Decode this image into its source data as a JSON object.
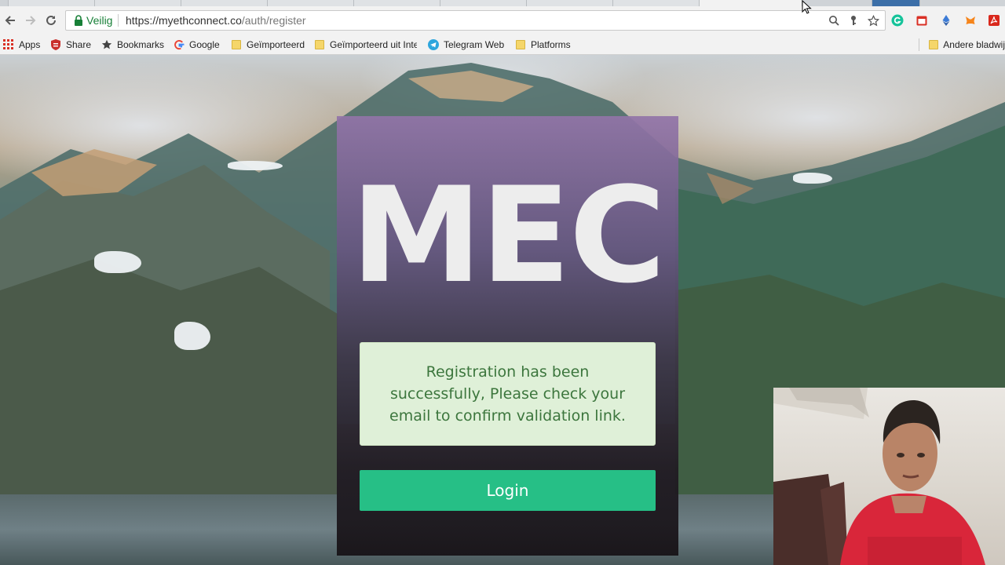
{
  "browser": {
    "address_bar": {
      "secure_label": "Veilig",
      "url_host": "https://myethconnect.co",
      "url_path": "/auth/register"
    },
    "bookmarks": [
      {
        "label": "Apps",
        "icon": "apps-grid-icon"
      },
      {
        "label": "Share",
        "icon": "share-icon"
      },
      {
        "label": "Bookmarks",
        "icon": "star-icon"
      },
      {
        "label": "Google",
        "icon": "google-icon"
      },
      {
        "label": "Geïmporteerd",
        "icon": "folder-icon"
      },
      {
        "label": "Geïmporteerd uit Inte",
        "icon": "folder-icon"
      },
      {
        "label": "Telegram Web",
        "icon": "telegram-icon"
      },
      {
        "label": "Platforms",
        "icon": "folder-icon"
      }
    ],
    "other_bookmarks": "Andere bladwij",
    "colors": {
      "secure_green": "#188038",
      "folder_yellow": "#f5d66a"
    }
  },
  "page": {
    "brand": "MEC",
    "alert": {
      "message": "Registration has been successfully, Please check your email to confirm validation link."
    },
    "login_button": "Login",
    "colors": {
      "accent": "#26bf86",
      "alert_bg": "#dff0d8",
      "alert_text": "#3c763d"
    }
  }
}
